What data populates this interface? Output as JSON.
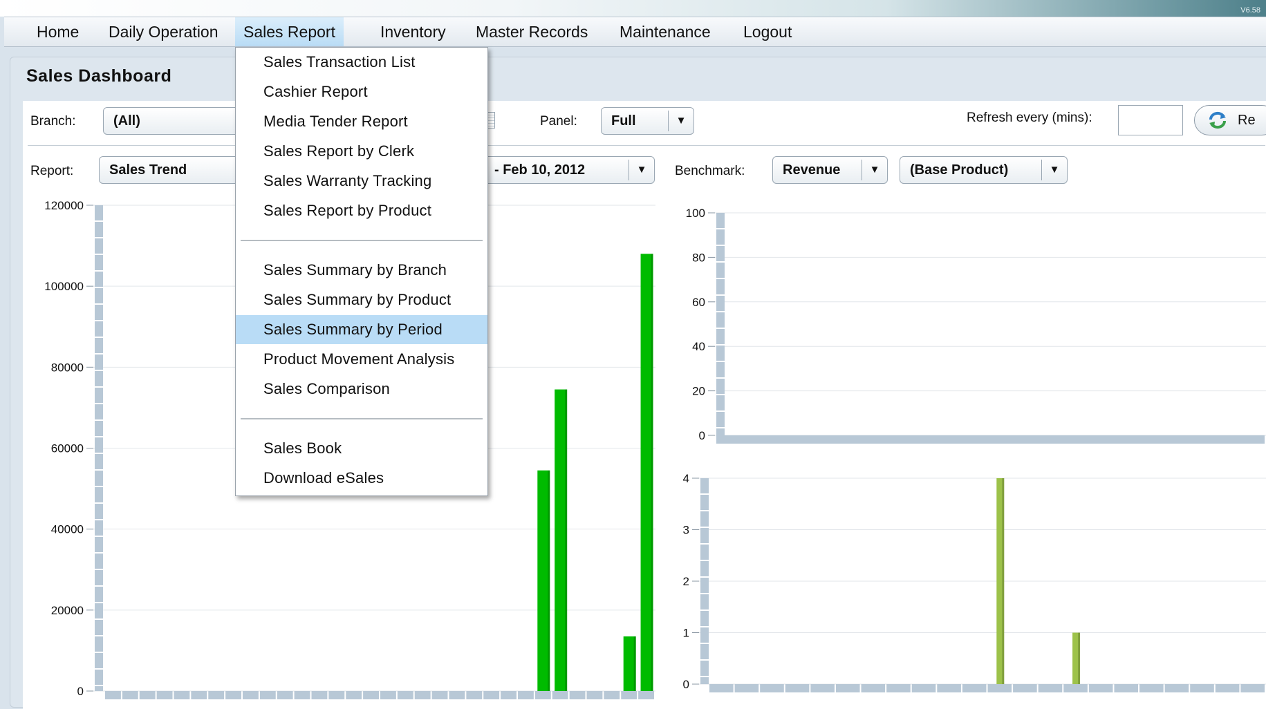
{
  "version": "V6.58",
  "menu": {
    "items": [
      "Home",
      "Daily Operation",
      "Sales Report",
      "Inventory",
      "Master Records",
      "Maintenance",
      "Logout"
    ],
    "active": "Sales Report"
  },
  "dropdown": {
    "groups": [
      [
        "Sales Transaction List",
        "Cashier Report",
        "Media Tender Report",
        "Sales Report by Clerk",
        "Sales Warranty Tracking",
        "Sales Report by Product"
      ],
      [
        "Sales Summary by Branch",
        "Sales Summary by Product",
        "Sales Summary by Period",
        "Product Movement Analysis",
        "Sales Comparison"
      ],
      [
        "Sales Book",
        "Download eSales"
      ]
    ],
    "highlighted": "Sales Summary by Period"
  },
  "page_title": "Sales Dashboard",
  "filters": {
    "branch_label": "Branch:",
    "branch_value": "(All)",
    "panel_label": "Panel:",
    "panel_value": "Full",
    "refresh_label": "Refresh every (mins):",
    "refresh_value": "",
    "refresh_button_label": "Re",
    "report_label": "Report:",
    "report_value": "Sales Trend",
    "period_value": "- Feb 10, 2012",
    "benchmark_label": "Benchmark:",
    "benchmark_value": "Revenue",
    "product_value": "(Base Product)"
  },
  "colors": {
    "bar_left": "#00bb00",
    "bar_right_bottom": "#9dc24a",
    "axis_bar": "#b8c8d6",
    "highlight": "#b9dcf6"
  },
  "chart_data": [
    {
      "type": "bar",
      "ylim": [
        0,
        120000
      ],
      "yticks": [
        "120000",
        "100000",
        "80000",
        "60000",
        "40000",
        "20000",
        "0"
      ],
      "x": [
        1,
        2,
        3,
        4,
        5,
        6,
        7,
        8,
        9,
        10,
        11,
        12,
        13,
        14,
        15,
        16,
        17,
        18,
        19,
        20,
        21,
        22,
        23,
        24,
        25,
        26,
        27,
        28,
        29,
        30,
        31,
        32
      ],
      "values": [
        0,
        0,
        0,
        0,
        0,
        0,
        0,
        0,
        0,
        0,
        0,
        0,
        0,
        0,
        0,
        0,
        0,
        0,
        0,
        0,
        0,
        0,
        0,
        0,
        0,
        54500,
        74500,
        0,
        0,
        0,
        13500,
        108000
      ],
      "xlabel": "",
      "ylabel": ""
    },
    {
      "type": "bar",
      "ylim": [
        0,
        100
      ],
      "yticks": [
        "100",
        "80",
        "60",
        "40",
        "20",
        "0"
      ],
      "values": [],
      "xlabel": "",
      "ylabel": ""
    },
    {
      "type": "bar",
      "ylim": [
        0,
        4
      ],
      "yticks": [
        "4",
        "3",
        "2",
        "1",
        "0"
      ],
      "x": [
        1,
        2,
        3,
        4,
        5,
        6,
        7,
        8,
        9,
        10,
        11,
        12,
        13,
        14,
        15,
        16,
        17,
        18,
        19,
        20,
        21,
        22
      ],
      "values": [
        0,
        0,
        0,
        0,
        0,
        0,
        0,
        0,
        0,
        0,
        0,
        4,
        0,
        0,
        1,
        0,
        0,
        0,
        0,
        0,
        0,
        0
      ],
      "xlabel": "",
      "ylabel": ""
    }
  ]
}
